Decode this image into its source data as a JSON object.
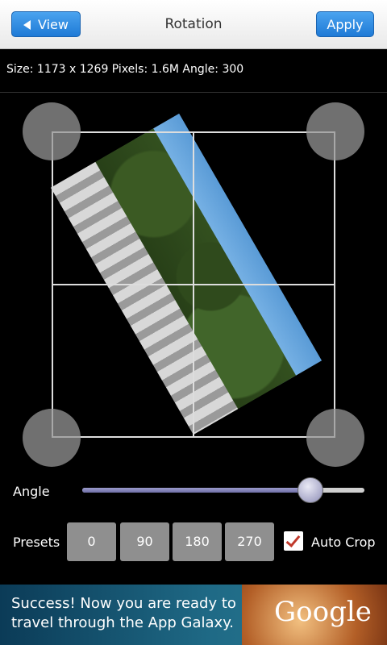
{
  "header": {
    "back_label": "View",
    "title": "Rotation",
    "apply_label": "Apply"
  },
  "info": {
    "text": "Size: 1173 x 1269 Pixels: 1.6M Angle: 300"
  },
  "angle": {
    "label": "Angle",
    "value": 300,
    "min": 0,
    "max": 360
  },
  "presets": {
    "label": "Presets",
    "options": [
      "0",
      "90",
      "180",
      "270"
    ]
  },
  "auto_crop": {
    "label": "Auto Crop",
    "checked": true
  },
  "ad": {
    "text": "Success! Now you are ready to travel through the App Galaxy.",
    "logo": "Google"
  },
  "colors": {
    "accent": "#1f7ad6",
    "check": "#c0392b"
  }
}
